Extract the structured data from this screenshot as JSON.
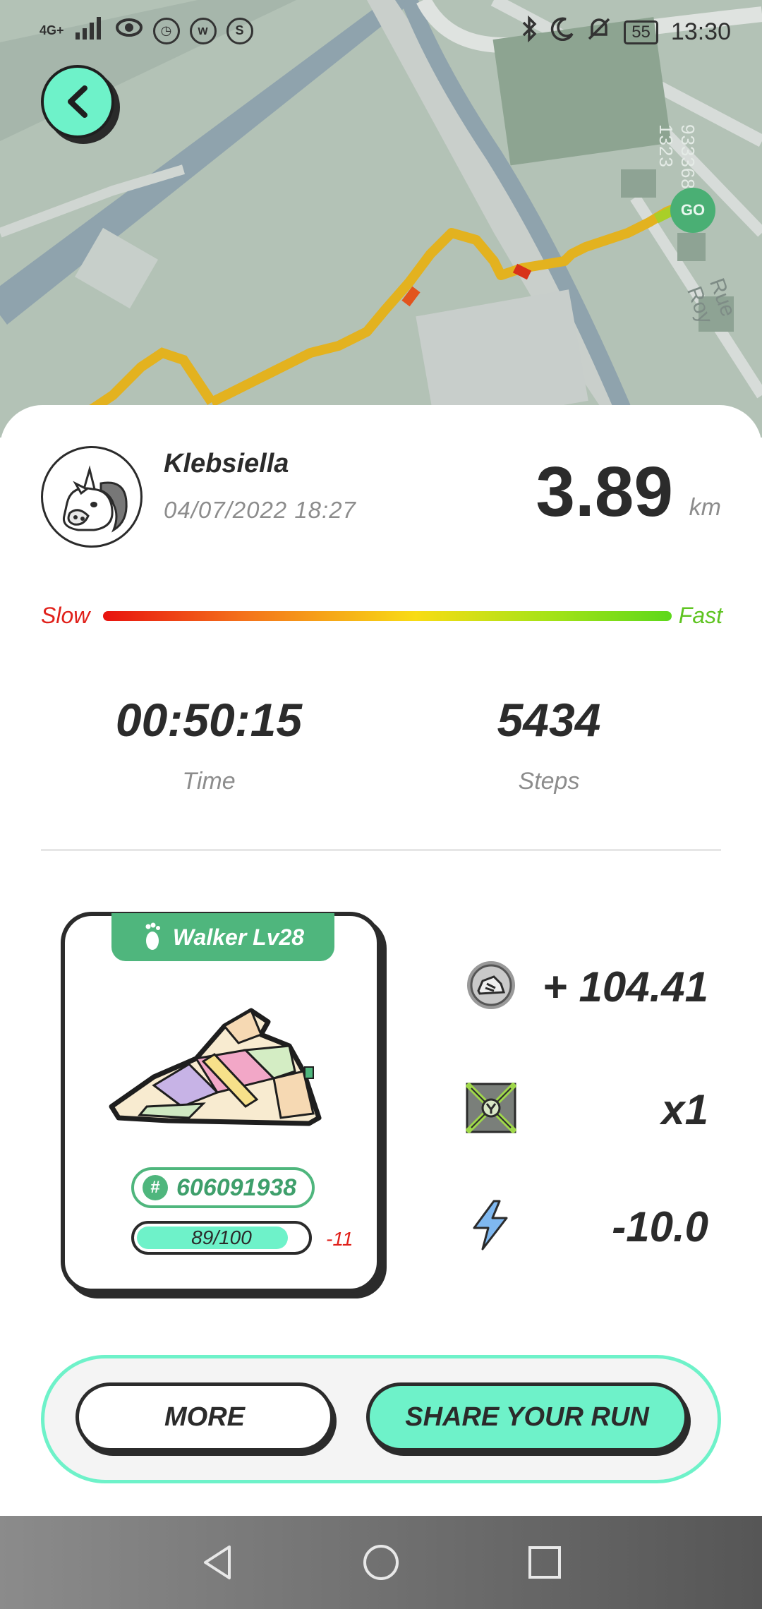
{
  "status_bar": {
    "network": "4G+",
    "time": "13:30",
    "battery": "55"
  },
  "map": {
    "go_label": "GO",
    "vertical_id": "9333680 1323",
    "street_label": "Rue Roy"
  },
  "run": {
    "user_name": "Klebsiella",
    "date": "04/07/2022 18:27",
    "distance": "3.89",
    "distance_unit": "km",
    "speed_slow_label": "Slow",
    "speed_fast_label": "Fast",
    "time_value": "00:50:15",
    "time_label": "Time",
    "steps_value": "5434",
    "steps_label": "Steps"
  },
  "sneaker": {
    "level_tag": "Walker Lv28",
    "id_hash": "#",
    "id": "606091938",
    "durability_text": "89/100",
    "durability_fraction": 0.89,
    "durability_loss": "-11"
  },
  "rewards": [
    {
      "icon": "gst-coin-icon",
      "value": "+ 104.41"
    },
    {
      "icon": "mystery-box-icon",
      "value": "x1"
    },
    {
      "icon": "energy-bolt-icon",
      "value": "-10.0"
    }
  ],
  "actions": {
    "more_label": "MORE",
    "share_label": "SHARE YOUR RUN"
  },
  "colors": {
    "accent": "#6ef2c9",
    "brand_green": "#4fb67d",
    "slow": "#e0201a",
    "fast": "#5fc421"
  }
}
